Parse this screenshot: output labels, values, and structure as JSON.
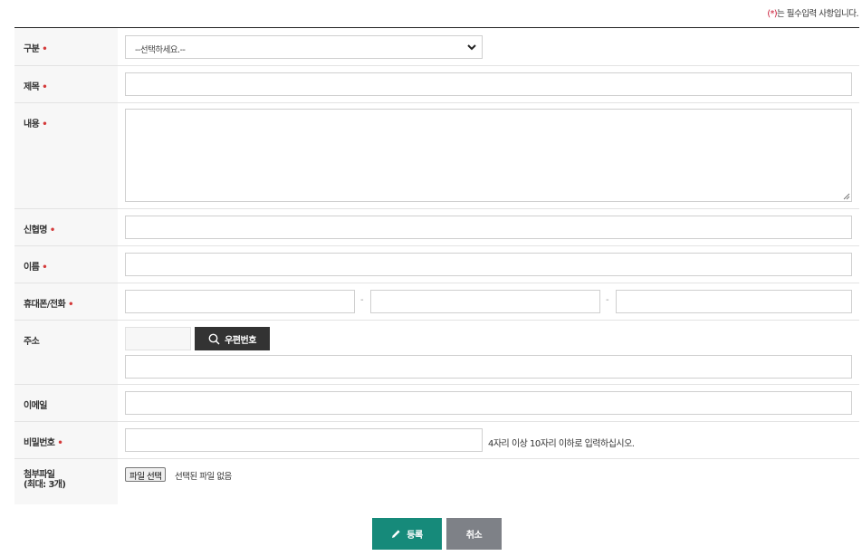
{
  "required_note": {
    "star": "(*)",
    "text": "는 필수입력 사항입니다."
  },
  "required_mark": "•",
  "fields": {
    "category": {
      "label": "구분",
      "selected": "--선택하세요.--"
    },
    "title": {
      "label": "제목"
    },
    "content": {
      "label": "내용"
    },
    "association": {
      "label": "신협명"
    },
    "name": {
      "label": "이름"
    },
    "phone": {
      "label": "휴대폰/전화",
      "separator": "-"
    },
    "address": {
      "label": "주소",
      "zip_button": "우편번호"
    },
    "email": {
      "label": "이메일"
    },
    "password": {
      "label": "비밀번호",
      "hint": "4자리 이상 10자리 이하로 입력하십시오."
    },
    "attachment": {
      "label_line1": "첨부파일",
      "label_line2": "(최대: 3개)",
      "button": "파일 선택",
      "status": "선택된 파일 없음"
    }
  },
  "actions": {
    "submit": "등록",
    "cancel": "취소"
  },
  "icons": {
    "zip": "search-icon",
    "submit": "pencil-icon",
    "select": "chevron-down-icon"
  },
  "colors": {
    "required": "#d43a3a",
    "submit_bg": "#168a7a",
    "cancel_bg": "#7e8187",
    "zip_bg": "#333333"
  }
}
